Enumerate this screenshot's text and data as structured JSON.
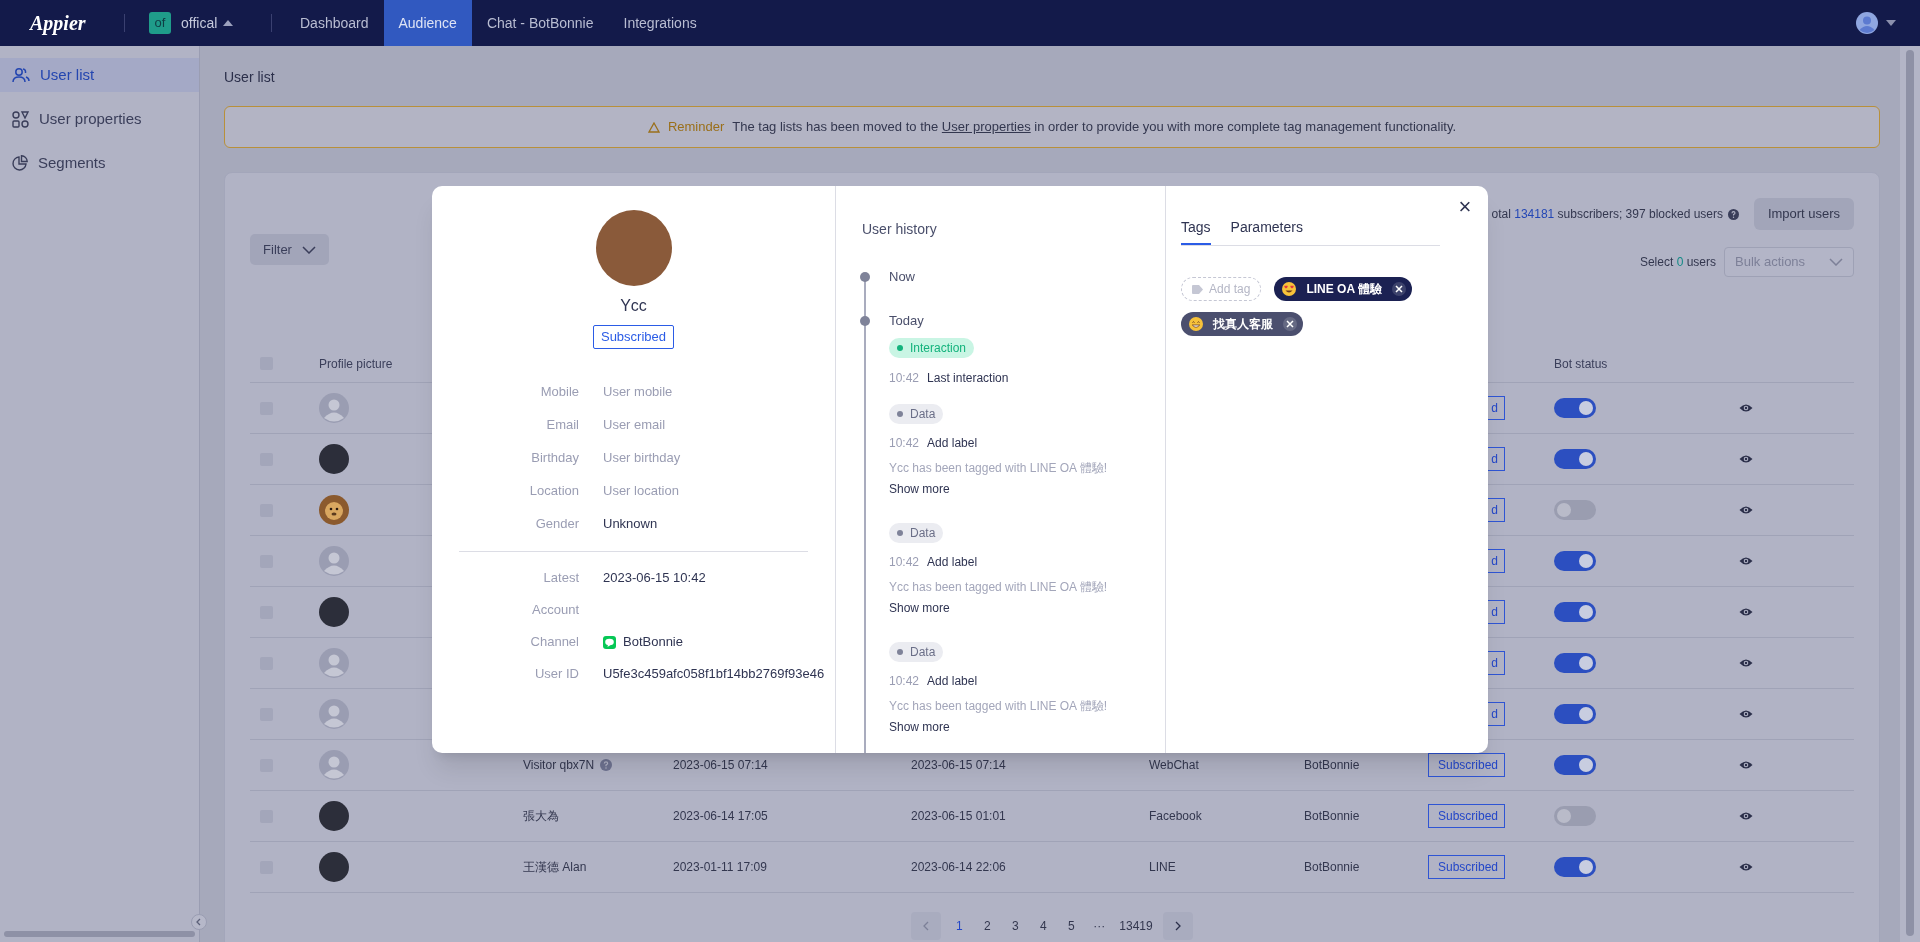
{
  "top_nav": {
    "logo": "Appier",
    "workspace": {
      "badge": "of",
      "name": "offical"
    },
    "tabs": [
      {
        "label": "Dashboard",
        "selected": false
      },
      {
        "label": "Audience",
        "selected": true
      },
      {
        "label": "Chat - BotBonnie",
        "selected": false
      },
      {
        "label": "Integrations",
        "selected": false
      }
    ]
  },
  "sidebar": {
    "items": [
      {
        "label": "User list",
        "selected": true
      },
      {
        "label": "User properties",
        "selected": false
      },
      {
        "label": "Segments",
        "selected": false
      }
    ]
  },
  "page_title": "User list",
  "reminder": {
    "label": "Reminder",
    "before": "The tag lists has been moved to the",
    "link": "User properties",
    "after": "in order to provide you with more complete tag management functionality."
  },
  "toolbar": {
    "filter": "Filter",
    "summary": {
      "prefix": "otal",
      "subscribers": "134181",
      "suffix": "subscribers; 397 blocked users"
    },
    "import": "Import users",
    "selection": {
      "before": "Select",
      "count": "0",
      "after": "users"
    },
    "bulk_actions": "Bulk actions"
  },
  "table": {
    "select_all": {
      "checked": false
    },
    "headers": {
      "profile_picture": "Profile picture",
      "bot_status": "Bot status"
    },
    "rows": [
      {
        "kind": "default",
        "checked": false,
        "status": "d",
        "bot_on": true
      },
      {
        "kind": "photo",
        "checked": false,
        "status": "d",
        "bot_on": true
      },
      {
        "kind": "cartoon",
        "checked": false,
        "status": "d",
        "bot_on": false
      },
      {
        "kind": "default",
        "checked": false,
        "status": "d",
        "bot_on": true
      },
      {
        "kind": "photo",
        "checked": false,
        "status": "d",
        "bot_on": true
      },
      {
        "kind": "default",
        "checked": false,
        "status": "d",
        "bot_on": true
      },
      {
        "kind": "default",
        "checked": false,
        "status": "d",
        "bot_on": true
      },
      {
        "kind": "default",
        "checked": false,
        "name": "Visitor qbx7N",
        "name_help": true,
        "created": "2023-06-15 07:14",
        "latest": "2023-06-15 07:14",
        "channel": "WebChat",
        "account": "BotBonnie",
        "status": "Subscribed",
        "bot_on": true
      },
      {
        "kind": "photo",
        "checked": false,
        "name": "張大為",
        "name_help": false,
        "created": "2023-06-14 17:05",
        "latest": "2023-06-15 01:01",
        "channel": "Facebook",
        "account": "BotBonnie",
        "status": "Subscribed",
        "bot_on": false
      },
      {
        "kind": "photo",
        "checked": false,
        "name": "王漢德 Alan",
        "name_help": false,
        "created": "2023-01-11 17:09",
        "latest": "2023-06-14 22:06",
        "channel": "LINE",
        "account": "BotBonnie",
        "status": "Subscribed",
        "bot_on": true
      }
    ]
  },
  "pagination": {
    "pages": [
      {
        "label": "1",
        "selected": true
      },
      {
        "label": "2",
        "selected": false
      },
      {
        "label": "3",
        "selected": false
      },
      {
        "label": "4",
        "selected": false
      },
      {
        "label": "5",
        "selected": false
      },
      {
        "label": "···",
        "selected": false
      },
      {
        "label": "13419",
        "selected": false
      }
    ]
  },
  "modal": {
    "close": "×",
    "profile": {
      "name": "Ycc",
      "status": "Subscribed"
    },
    "fields": [
      {
        "label": "Mobile",
        "value": "User mobile",
        "empty": true
      },
      {
        "label": "Email",
        "value": "User email",
        "empty": true
      },
      {
        "label": "Birthday",
        "value": "User birthday",
        "empty": true
      },
      {
        "label": "Location",
        "value": "User location",
        "empty": true
      },
      {
        "label": "Gender",
        "value": "Unknown",
        "empty": false
      }
    ],
    "details": [
      {
        "kind": "text",
        "label": "Latest",
        "value": "2023-06-15 10:42"
      },
      {
        "kind": "text",
        "label": "Account"
      },
      {
        "kind": "channel",
        "label": "Channel",
        "value": "BotBonnie"
      },
      {
        "kind": "text",
        "label": "User ID",
        "value": "U5fe3c459afc058f1bf14bb2769f93e46"
      }
    ],
    "history": {
      "title": "User history",
      "entries": [
        {
          "kind": "marker",
          "label": "Now"
        },
        {
          "kind": "marker",
          "label": "Today"
        },
        {
          "kind": "interaction",
          "badge": "Interaction",
          "time": "10:42",
          "title": "Last interaction"
        },
        {
          "kind": "data",
          "badge": "Data",
          "time": "10:42",
          "title": "Add label",
          "detail": "Ycc has been tagged with LINE OA 體驗!",
          "more": "Show more"
        },
        {
          "kind": "data",
          "badge": "Data",
          "time": "10:42",
          "title": "Add label",
          "detail": "Ycc has been tagged with LINE OA 體驗!",
          "more": "Show more"
        },
        {
          "kind": "data",
          "badge": "Data",
          "time": "10:42",
          "title": "Add label",
          "detail": "Ycc has been tagged with LINE OA 體驗!",
          "more": "Show more"
        }
      ]
    },
    "tabs": [
      {
        "label": "Tags",
        "selected": true
      },
      {
        "label": "Parameters",
        "selected": false
      }
    ],
    "tags": {
      "add": "Add tag",
      "items": [
        {
          "kind": "heart_eyes",
          "label": "LINE OA 體驗",
          "color": "#1b2152"
        },
        {
          "kind": "grinning",
          "label": "找真人客服",
          "color": "#4b4f6e"
        }
      ]
    }
  }
}
